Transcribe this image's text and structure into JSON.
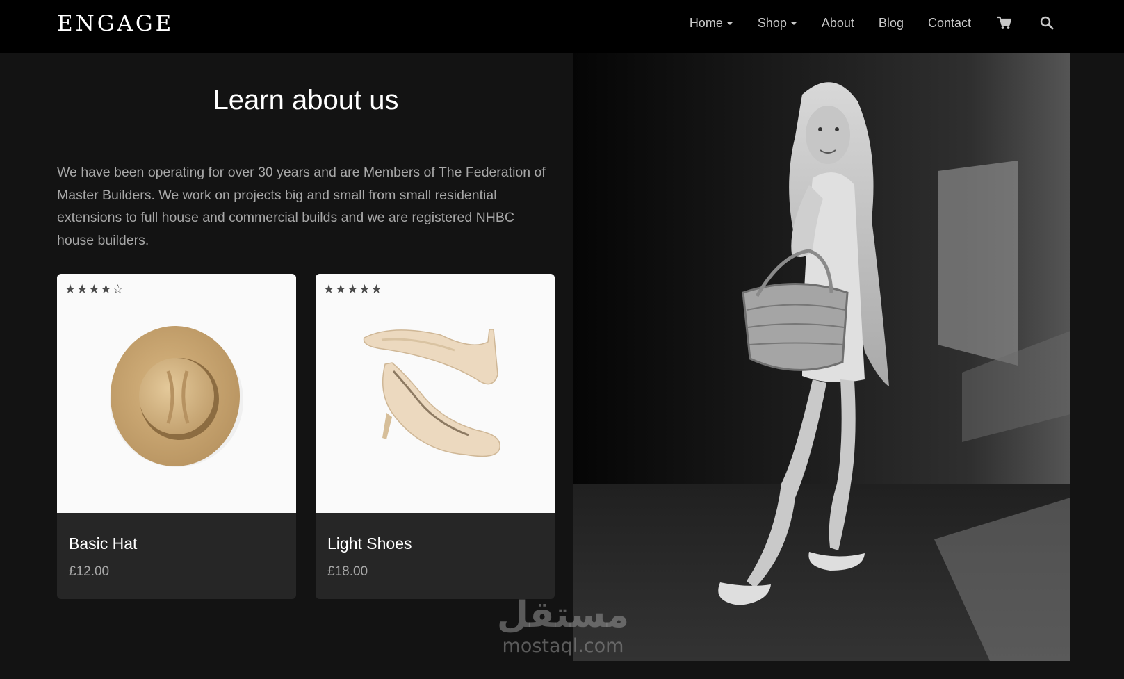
{
  "header": {
    "logo": "ENGAGE",
    "nav": [
      {
        "label": "Home",
        "dropdown": true
      },
      {
        "label": "Shop",
        "dropdown": true
      },
      {
        "label": "About",
        "dropdown": false
      },
      {
        "label": "Blog",
        "dropdown": false
      },
      {
        "label": "Contact",
        "dropdown": false
      }
    ],
    "icons": [
      "cart-icon",
      "search-icon"
    ]
  },
  "about": {
    "title": "Learn about us",
    "text": "We have been operating for over 30 years and are Members of The Federation of Master Builders. We work on projects big and small from small residential extensions to full house and commercial builds and we are registered NHBC house builders."
  },
  "products": [
    {
      "name": "Basic Hat",
      "price": "£12.00",
      "rating": "★★★★☆",
      "image_icon": "hat-image"
    },
    {
      "name": "Light Shoes",
      "price": "£18.00",
      "rating": "★★★★★",
      "image_icon": "shoes-image"
    }
  ],
  "hero_image": "girl-with-basket-photo",
  "watermark": {
    "arabic": "مستقل",
    "latin": "mostaql.com"
  },
  "colors": {
    "background": "#131313",
    "navbar": "#000000",
    "card": "#262626",
    "text_muted": "#a8a8a8"
  }
}
